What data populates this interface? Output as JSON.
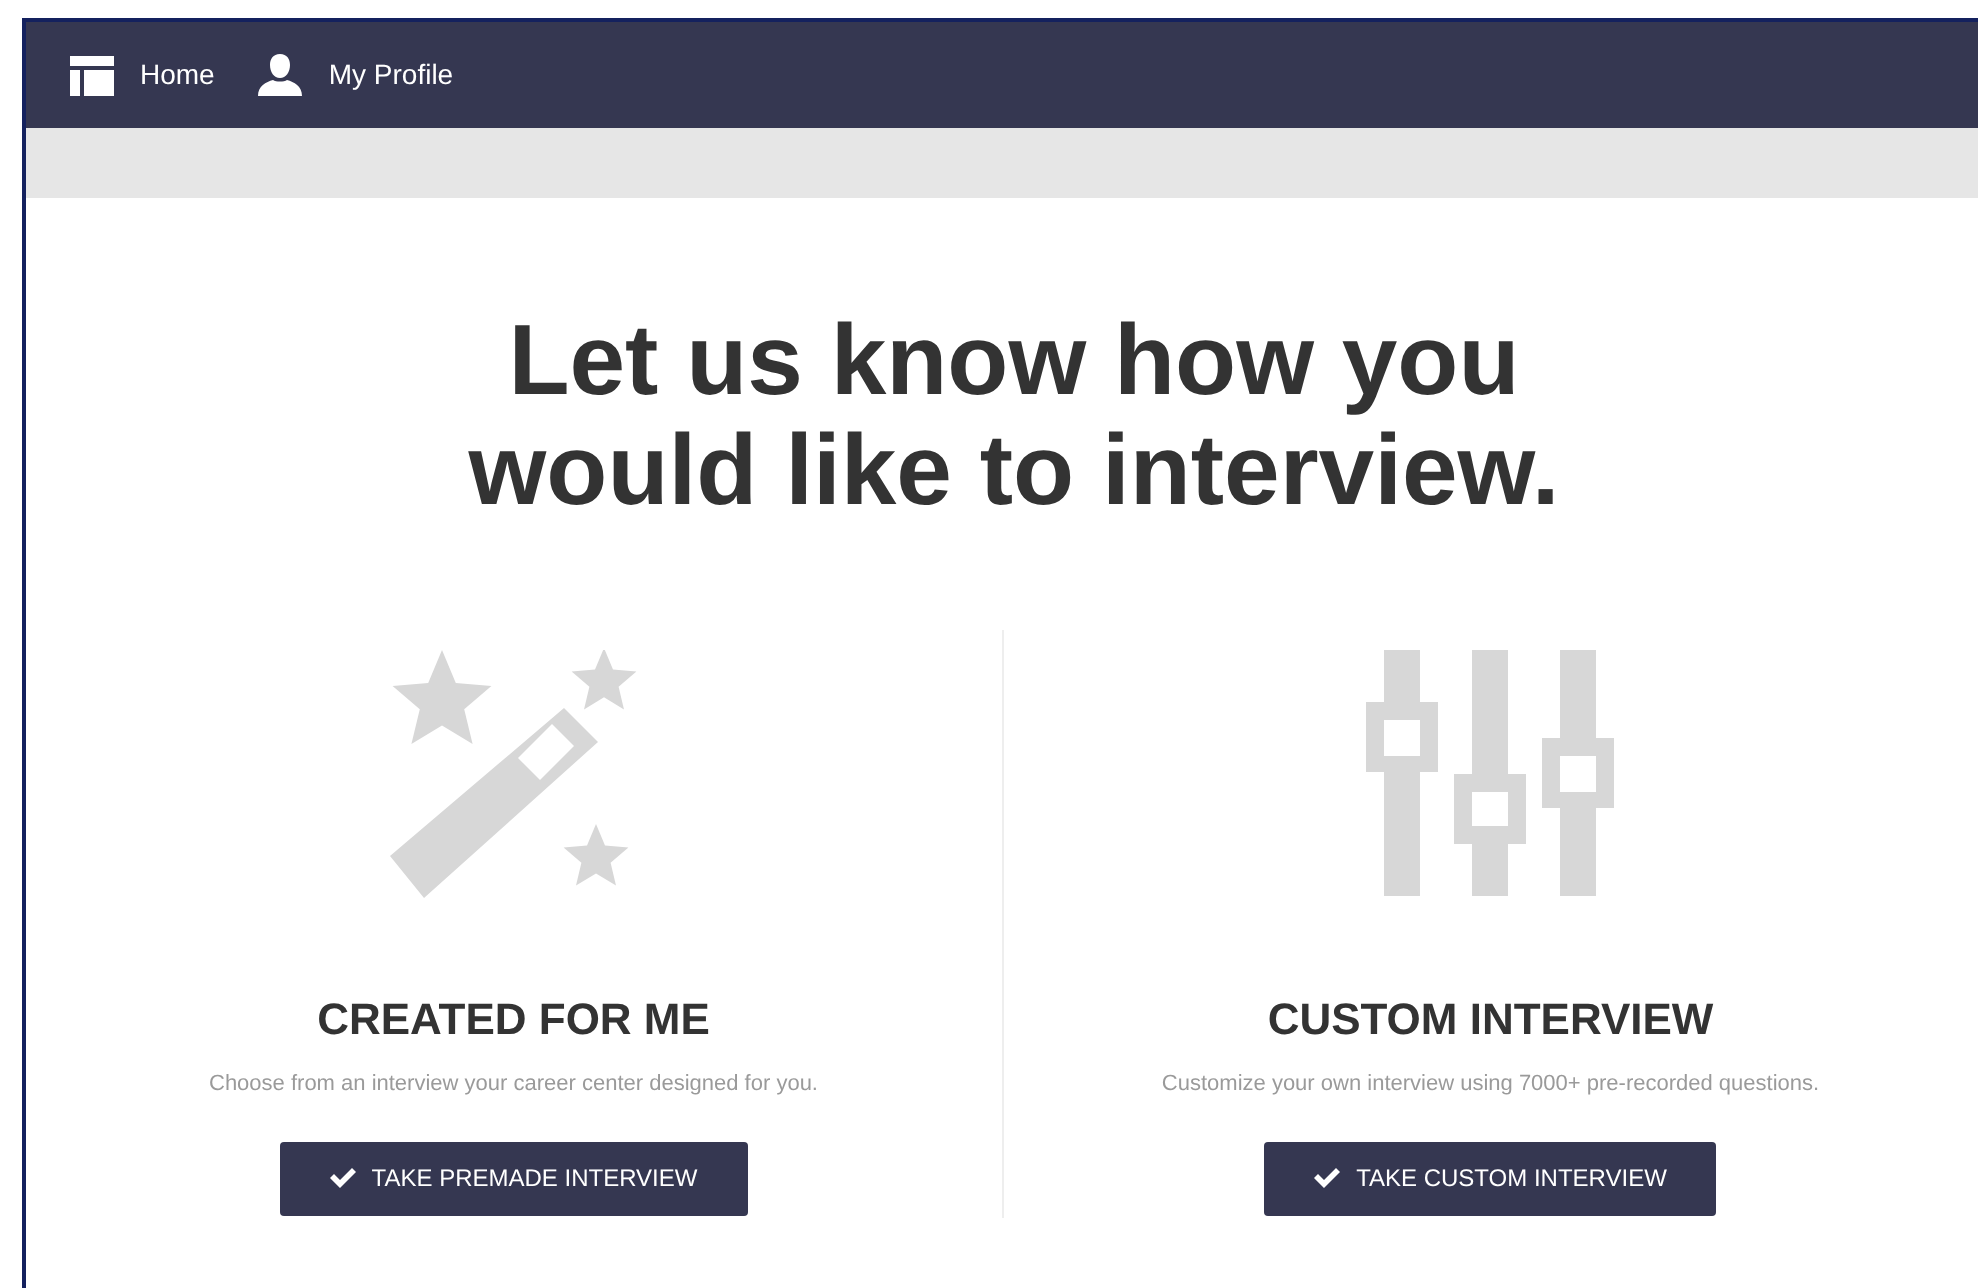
{
  "nav": [
    {
      "label": "Home",
      "kind": "layout"
    },
    {
      "label": "My Profile",
      "kind": "user"
    }
  ],
  "heading": [
    "Let us know how you",
    "would like to interview."
  ],
  "options": [
    {
      "kind": "wand",
      "title": "CREATED FOR ME",
      "description": "Choose from an interview your career center designed for you.",
      "button": "TAKE PREMADE INTERVIEW"
    },
    {
      "kind": "sliders",
      "title": "CUSTOM INTERVIEW",
      "description": "Customize your own interview using 7000+ pre-recorded questions.",
      "button": "TAKE CUSTOM INTERVIEW"
    }
  ]
}
